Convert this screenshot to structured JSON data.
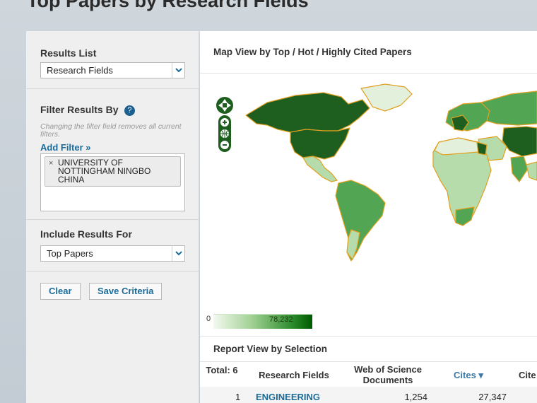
{
  "page": {
    "title": "Top Papers by Research Fields"
  },
  "sidebar": {
    "results_list": {
      "label": "Results List",
      "selected": "Research Fields"
    },
    "filter": {
      "label": "Filter Results By",
      "help": "?",
      "note": "Changing the filter field removes all current filters.",
      "add_filter": "Add Filter »",
      "chips": [
        {
          "remove": "×",
          "text": "UNIVERSITY OF NOTTINGHAM NINGBO CHINA"
        }
      ]
    },
    "include": {
      "label": "Include Results For",
      "selected": "Top Papers"
    },
    "buttons": {
      "clear": "Clear",
      "save": "Save Criteria"
    }
  },
  "map": {
    "title": "Map View by Top / Hot / Highly Cited Papers",
    "legend_min": "0",
    "legend_max": "78,232",
    "colors": {
      "dark": "#1e5e1e",
      "mid": "#52a552",
      "light": "#b7dcac",
      "pale": "#e3f0dc",
      "border": "#e0a020"
    }
  },
  "report": {
    "title": "Report View by Selection",
    "columns": {
      "total": "Total: 6",
      "field": "Research Fields",
      "docs": "Web of Science Documents",
      "cites": "Cites ▾",
      "cites_per": "Cite"
    },
    "rows": [
      {
        "rank": "1",
        "field": "ENGINEERING",
        "docs": "1,254",
        "cites": "27,347"
      }
    ]
  }
}
